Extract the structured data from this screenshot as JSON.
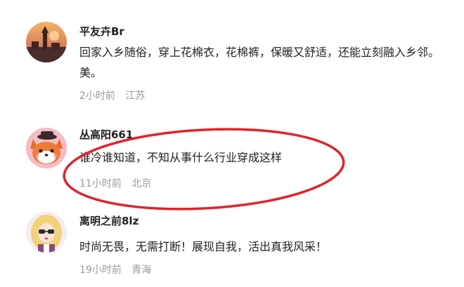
{
  "comments": [
    {
      "username": "平友卉Br",
      "text": "回家入乡随俗，穿上花棉衣，花棉裤，保暖又舒适，还能立刻融入乡邻。美。",
      "time": "2小时前",
      "location": "江苏",
      "avatar": "sunset-tower-photo"
    },
    {
      "username": "丛高阳661",
      "text": "谁冷谁知道，不知从事什么行业穿成这样",
      "time": "11小时前",
      "location": "北京",
      "avatar": "cartoon-fox-with-hat"
    },
    {
      "username": "离明之前8lz",
      "text": "时尚无畏，无需打断！展现自我，活出真我风采！",
      "time": "19小时前",
      "location": "青海",
      "avatar": "cartoon-girl-blonde"
    }
  ],
  "highlight_color": "#e0242c"
}
